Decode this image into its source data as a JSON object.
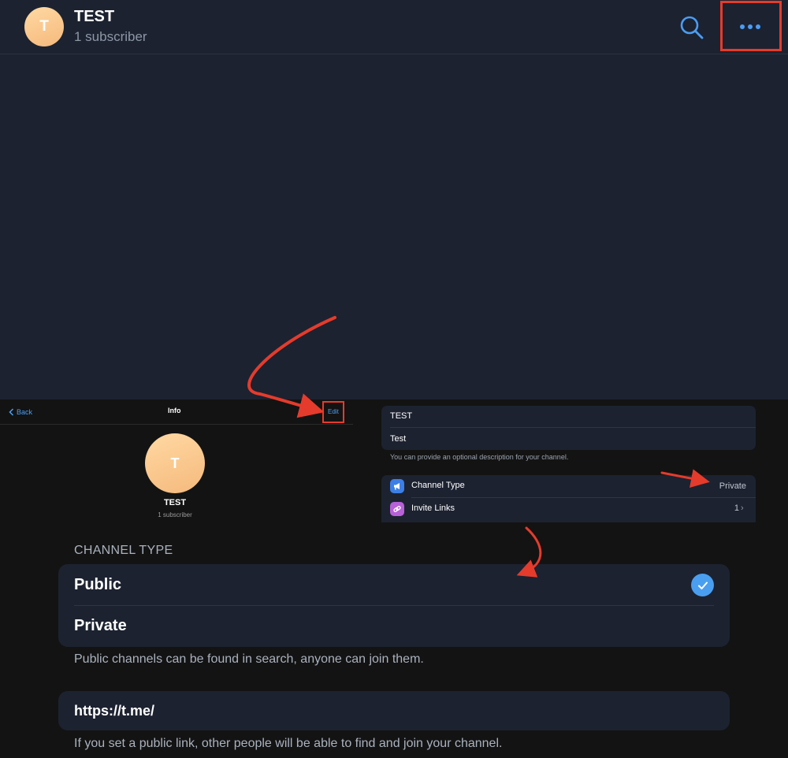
{
  "colors": {
    "accent": "#4b9cf2",
    "annotation": "#e53b2c",
    "panel": "#1c2230",
    "background": "#131313"
  },
  "top_header": {
    "avatar_letter": "T",
    "title": "TEST",
    "subtitle": "1 subscriber",
    "search_icon": "search-icon",
    "more_icon": "more-dots-icon"
  },
  "info_screen": {
    "back_label": "Back",
    "title": "Info",
    "edit_label": "Edit",
    "avatar_letter": "T",
    "name": "TEST",
    "subscribers": "1 subscriber"
  },
  "edit_screen": {
    "name_value": "TEST",
    "description_value": "Test",
    "description_hint": "You can provide an optional description for your channel.",
    "channel_type_label": "Channel Type",
    "channel_type_value": "Private",
    "invite_links_label": "Invite Links",
    "invite_links_count": "1",
    "chevron": "›"
  },
  "channel_type_screen": {
    "section_title": "CHANNEL TYPE",
    "options": [
      {
        "label": "Public",
        "selected": true
      },
      {
        "label": "Private",
        "selected": false
      }
    ],
    "hint": "Public channels can be found in search, anyone can join them.",
    "link_value": "https://t.me/",
    "link_hint": "If you set a public link, other people will be able to find and join your channel."
  }
}
